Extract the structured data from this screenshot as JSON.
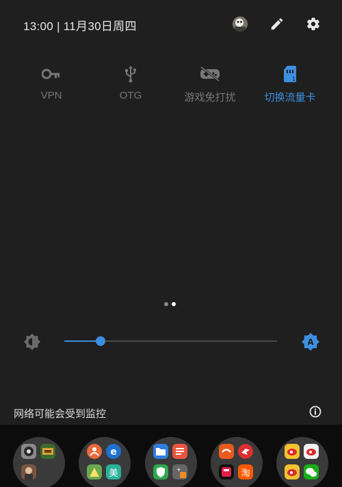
{
  "status": {
    "time_date": "13:00 | 11月30日周四"
  },
  "tiles": [
    {
      "label": "VPN",
      "icon": "key-icon"
    },
    {
      "label": "OTG",
      "icon": "usb-icon"
    },
    {
      "label": "游戏免打扰",
      "icon": "game-dnd-icon"
    },
    {
      "label": "切换流量卡",
      "icon": "sim-card-icon"
    }
  ],
  "brightness": {
    "level": 0.17
  },
  "notice": {
    "text": "网络可能会受到监控"
  },
  "colors": {
    "accent": "#3d8fe0",
    "background": "#1f1f1f",
    "dock": "#0c0c0c"
  },
  "dock": {
    "folders": [
      {
        "apps": [
          "game-app-icon-1",
          "game-app-icon-2",
          "game-app-icon-3"
        ]
      },
      {
        "apps": [
          "orange-app-icon",
          "ie-app-icon",
          "green-app-icon",
          "meituan-app-icon"
        ],
        "texts": [
          "美"
        ]
      },
      {
        "apps": [
          "files-app-icon",
          "notes-app-icon",
          "security-app-icon",
          "calculator-app-icon"
        ]
      },
      {
        "apps": [
          "aliexpress-app-icon",
          "bird-app-icon",
          "tmall-app-icon",
          "taobao-app-icon"
        ],
        "texts": [
          "淘"
        ]
      },
      {
        "apps": [
          "weibo-app-icon",
          "weibo-app-icon-2",
          "weibo-app-icon-3",
          "wechat-app-icon"
        ]
      }
    ]
  }
}
